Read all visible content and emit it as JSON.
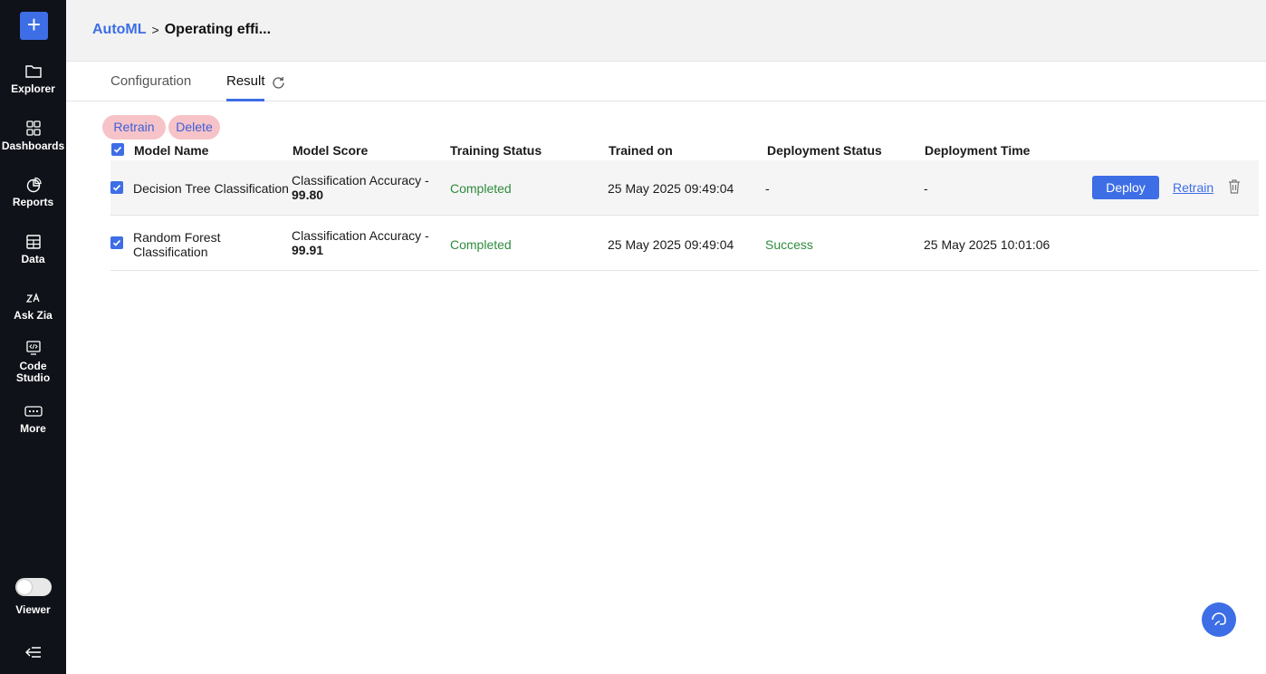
{
  "sidebar": {
    "items": [
      {
        "label": "Explorer",
        "icon": "folder-icon"
      },
      {
        "label": "Dashboards",
        "icon": "grid-icon"
      },
      {
        "label": "Reports",
        "icon": "pie-chart-icon"
      },
      {
        "label": "Data",
        "icon": "table-icon"
      },
      {
        "label": "Ask Zia",
        "icon": "zia-icon"
      },
      {
        "label": "Code Studio",
        "icon": "code-monitor-icon"
      },
      {
        "label": "More",
        "icon": "more-dots-icon"
      }
    ],
    "viewer_label": "Viewer",
    "viewer_toggle_on": false
  },
  "header": {
    "breadcrumb_root": "AutoML",
    "breadcrumb_sep": ">",
    "breadcrumb_current": "Operating effi..."
  },
  "tabs": {
    "configuration": "Configuration",
    "result": "Result",
    "active": "Result"
  },
  "actions": {
    "retrain": "Retrain",
    "delete": "Delete"
  },
  "table": {
    "columns": [
      "Model Name",
      "Model Score",
      "Training Status",
      "Trained on",
      "Deployment Status",
      "Deployment Time"
    ],
    "rows": [
      {
        "name": "Decision Tree Classification",
        "score_label": "Classification Accuracy -",
        "score_value": "99.80",
        "training_status": "Completed",
        "trained_on": "25 May 2025 09:49:04",
        "deployment_status": "-",
        "deployment_time": "-",
        "deploy_label": "Deploy",
        "retrain_label": "Retrain",
        "checked": true
      },
      {
        "name": "Random Forest Classification",
        "score_label": "Classification Accuracy -",
        "score_value": "99.91",
        "training_status": "Completed",
        "trained_on": "25 May 2025 09:49:04",
        "deployment_status": "Success",
        "deployment_time": "25 May 2025 10:01:06",
        "checked": true
      }
    ]
  },
  "colors": {
    "accent": "#3d6ee6",
    "sidebar_bg": "#0f1218",
    "success": "#2e8b3d",
    "pill_bg": "#f6c3c8"
  }
}
